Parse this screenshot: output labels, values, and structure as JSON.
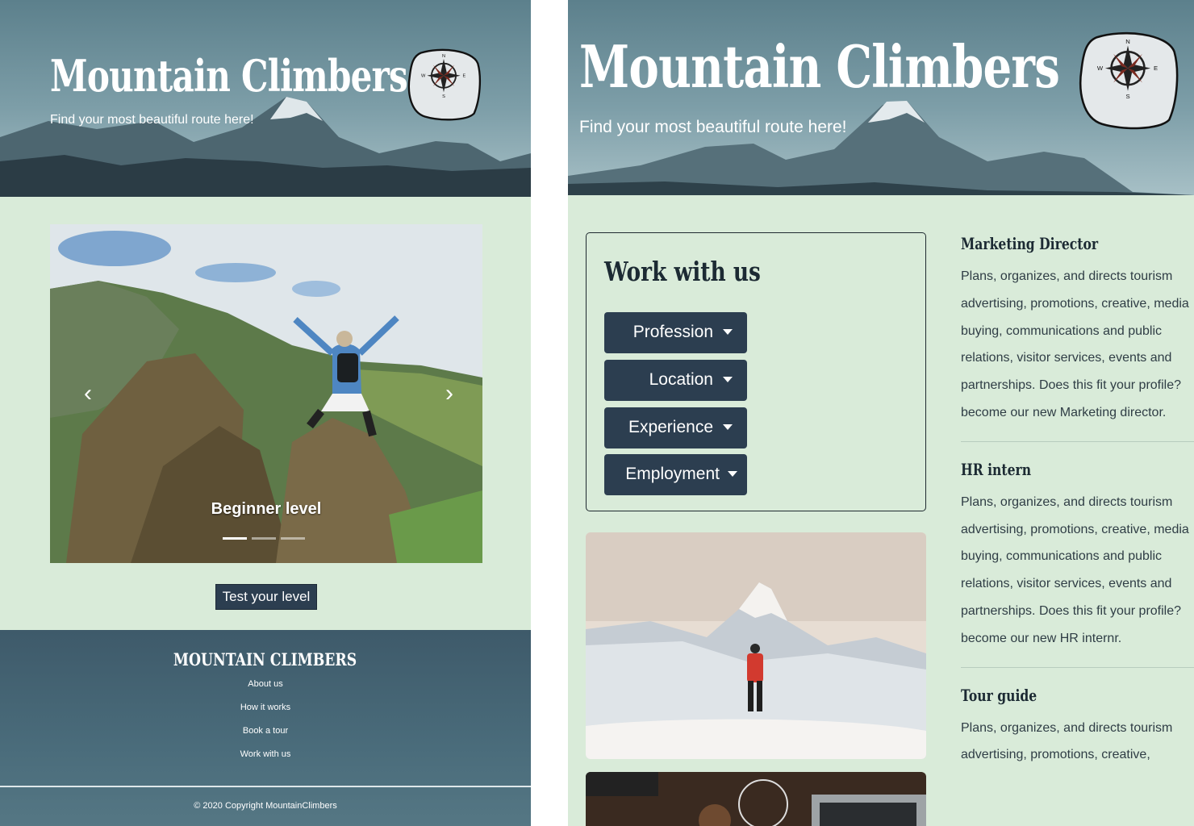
{
  "left_page": {
    "header": {
      "title": "Mountain Climbers",
      "tagline": "Find your most beautiful route here!"
    },
    "carousel": {
      "caption": "Beginner level",
      "slides_count": 3,
      "active_slide": 1
    },
    "cta": {
      "label": "Test your level"
    },
    "footer": {
      "title": "MOUNTAIN CLIMBERS",
      "links": [
        "About us",
        "How it works",
        "Book a tour",
        "Work with us"
      ],
      "copyright": "© 2020 Copyright MountainClimbers"
    }
  },
  "right_page": {
    "header": {
      "title": "Mountain Climbers",
      "tagline": "Find your most beautiful route here!"
    },
    "work": {
      "title": "Work with us",
      "filters": [
        "Profession",
        "Location",
        "Experience",
        "Employment"
      ]
    },
    "jobs": [
      {
        "title": "Marketing Director",
        "description": "Plans, organizes, and directs tourism advertising, promotions, creative, media buying, communications and public relations, visitor services, events and partnerships. Does this fit your profile? become our new Marketing director."
      },
      {
        "title": "HR intern",
        "description": "Plans, organizes, and directs tourism advertising, promotions, creative, media buying, communications and public relations, visitor services, events and partnerships. Does this fit your profile? become our new HR internr."
      },
      {
        "title": "Tour guide",
        "description": "Plans, organizes, and directs tourism advertising, promotions, creative,"
      }
    ]
  },
  "compass": {
    "letters": [
      "N",
      "E",
      "S",
      "W"
    ],
    "icon": "compass-icon"
  },
  "colors": {
    "page_bg": "#d9ebd9",
    "button": "#2c3e50",
    "footer": "#4a6c7b",
    "header_sky": "#7d9ea8"
  }
}
